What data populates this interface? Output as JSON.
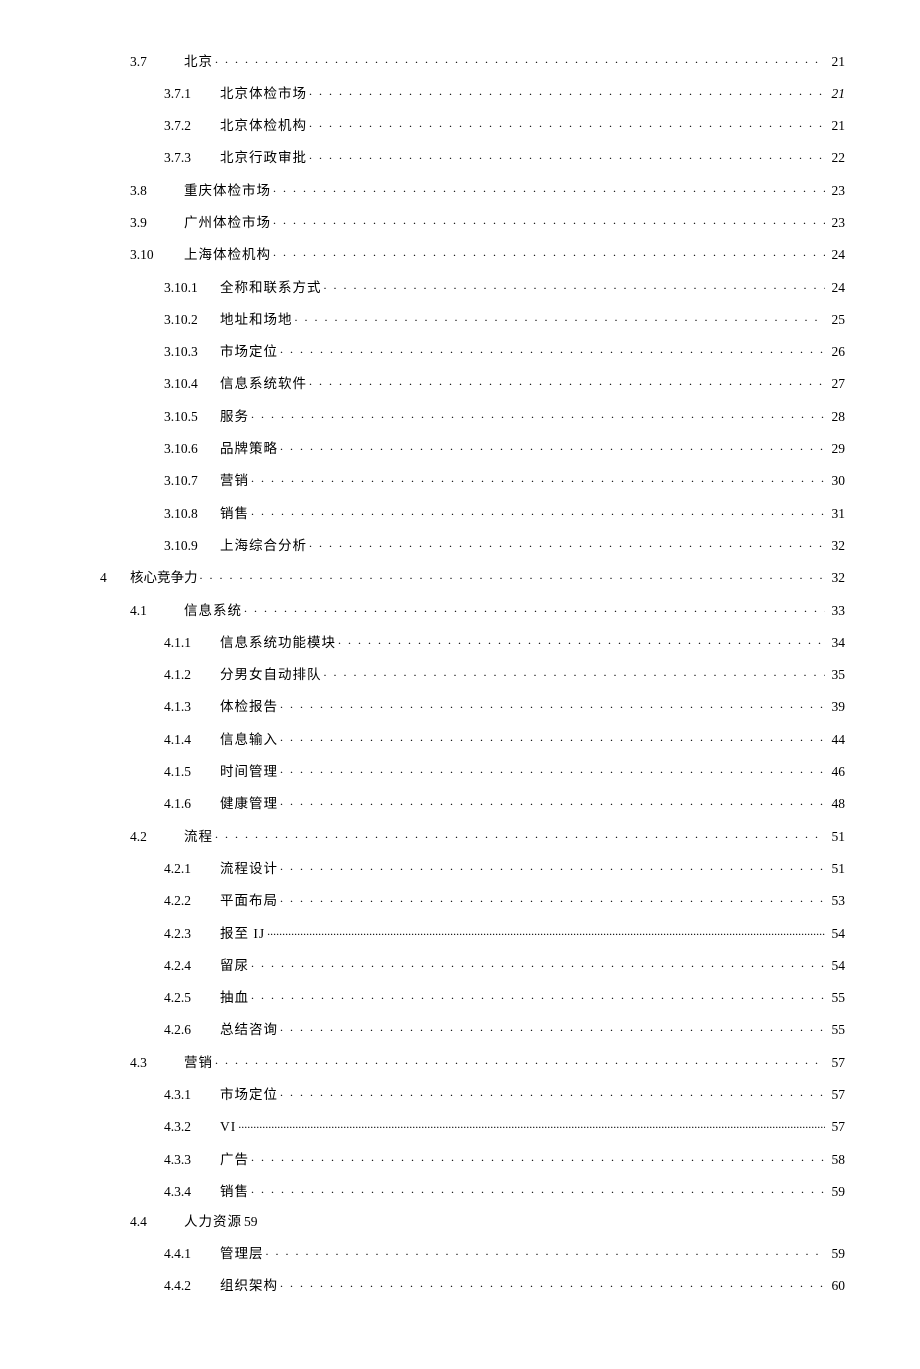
{
  "toc": [
    {
      "level": 1,
      "num": "3.7",
      "title": "北京",
      "page": "21"
    },
    {
      "level": 2,
      "num": "3.7.1",
      "title": "北京体检市场",
      "page": "21",
      "italicPage": true
    },
    {
      "level": 2,
      "num": "3.7.2",
      "title": "北京体检机构",
      "page": "21"
    },
    {
      "level": 2,
      "num": "3.7.3",
      "title": "北京行政审批",
      "page": "22"
    },
    {
      "level": 1,
      "num": "3.8",
      "title": "重庆体检市场",
      "page": "23"
    },
    {
      "level": 1,
      "num": "3.9",
      "title": "广州体检市场",
      "page": "23"
    },
    {
      "level": 1,
      "num": "3.10",
      "title": "上海体检机构",
      "page": "24"
    },
    {
      "level": 2,
      "num": "3.10.1",
      "title": "全称和联系方式",
      "page": "24"
    },
    {
      "level": 2,
      "num": "3.10.2",
      "title": "地址和场地",
      "page": "25"
    },
    {
      "level": 2,
      "num": "3.10.3",
      "title": "市场定位",
      "page": "26"
    },
    {
      "level": 2,
      "num": "3.10.4",
      "title": "信息系统软件",
      "page": "27"
    },
    {
      "level": 2,
      "num": "3.10.5",
      "title": "服务",
      "page": "28"
    },
    {
      "level": 2,
      "num": "3.10.6",
      "title": "品牌策略",
      "page": "29"
    },
    {
      "level": 2,
      "num": "3.10.7",
      "title": "营销",
      "page": "30"
    },
    {
      "level": 2,
      "num": "3.10.8",
      "title": "销售",
      "page": "31"
    },
    {
      "level": 2,
      "num": "3.10.9",
      "title": "上海综合分析",
      "page": "32"
    },
    {
      "level": 0,
      "num": "4",
      "title": "核心竞争力",
      "page": "32"
    },
    {
      "level": 1,
      "num": "4.1",
      "title": "信息系统",
      "page": "33"
    },
    {
      "level": 2,
      "num": "4.1.1",
      "title": "信息系统功能模块",
      "page": "34"
    },
    {
      "level": 2,
      "num": "4.1.2",
      "title": "分男女自动排队",
      "page": "35"
    },
    {
      "level": 2,
      "num": "4.1.3",
      "title": "体检报告",
      "page": "39"
    },
    {
      "level": 2,
      "num": "4.1.4",
      "title": "信息输入",
      "page": "44"
    },
    {
      "level": 2,
      "num": "4.1.5",
      "title": "时间管理",
      "page": "46"
    },
    {
      "level": 2,
      "num": "4.1.6",
      "title": "健康管理",
      "page": "48"
    },
    {
      "level": 1,
      "num": "4.2",
      "title": "流程",
      "page": "51"
    },
    {
      "level": 2,
      "num": "4.2.1",
      "title": "流程设计",
      "page": "51"
    },
    {
      "level": 2,
      "num": "4.2.2",
      "title": "平面布局",
      "page": "53"
    },
    {
      "level": 2,
      "num": "4.2.3",
      "title": "报至 IJ",
      "page": "54",
      "tightDots": true
    },
    {
      "level": 2,
      "num": "4.2.4",
      "title": "留尿",
      "page": "54"
    },
    {
      "level": 2,
      "num": "4.2.5",
      "title": "抽血",
      "page": "55"
    },
    {
      "level": 2,
      "num": "4.2.6",
      "title": "总结咨询",
      "page": "55"
    },
    {
      "level": 1,
      "num": "4.3",
      "title": "营销",
      "page": "57"
    },
    {
      "level": 2,
      "num": "4.3.1",
      "title": "市场定位",
      "page": "57"
    },
    {
      "level": 2,
      "num": "4.3.2",
      "title": "VI",
      "page": "57",
      "tightDots": true
    },
    {
      "level": 2,
      "num": "4.3.3",
      "title": "广告",
      "page": "58"
    },
    {
      "level": 2,
      "num": "4.3.4",
      "title": "销售",
      "page": "59"
    },
    {
      "level": 1,
      "num": "4.4",
      "title": "人力资源",
      "page": "59",
      "inlinePage": true
    },
    {
      "level": 2,
      "num": "4.4.1",
      "title": "管理层",
      "page": "59"
    },
    {
      "level": 2,
      "num": "4.4.2",
      "title": "组织架构",
      "page": "60"
    }
  ]
}
